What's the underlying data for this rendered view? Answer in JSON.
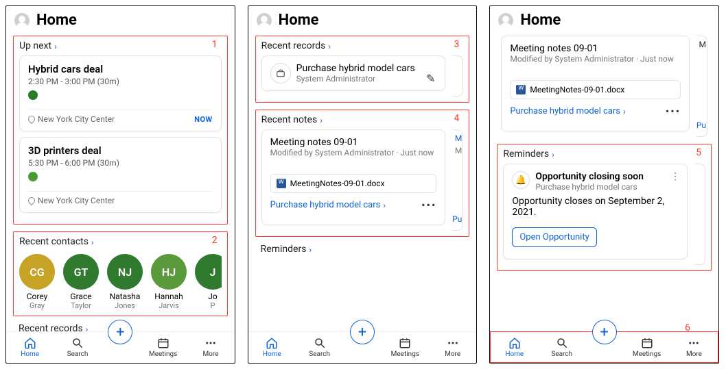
{
  "header": {
    "title": "Home"
  },
  "upnext": {
    "label": "Up next",
    "events": [
      {
        "title": "Hybrid cars deal",
        "time": "2:30 PM - 3:00 PM (30m)",
        "dot": "#2a7a2a",
        "loc": "New York City Center",
        "badge": "NOW"
      },
      {
        "title": "3D printers deal",
        "time": "5:30 PM - 6:00 PM (30m)",
        "dot": "#4a9a3a",
        "loc": "New York City Center",
        "badge": ""
      }
    ]
  },
  "recentContacts": {
    "label": "Recent contacts",
    "items": [
      {
        "initials": "CG",
        "color": "#c6a227",
        "first": "Corey",
        "last": "Gray"
      },
      {
        "initials": "GT",
        "color": "#2f7a2f",
        "first": "Grace",
        "last": "Taylor"
      },
      {
        "initials": "NJ",
        "color": "#2f7a2f",
        "first": "Natasha",
        "last": "Jones"
      },
      {
        "initials": "HJ",
        "color": "#5a9a3a",
        "first": "Hannah",
        "last": "Jarvis"
      },
      {
        "initials": "J",
        "color": "#2f7a2f",
        "first": "Jo",
        "last": "P"
      }
    ]
  },
  "recentRecords": {
    "label": "Recent records",
    "item": {
      "title": "Purchase hybrid model cars",
      "sub": "System Administrator"
    }
  },
  "recentNotes": {
    "label": "Recent notes",
    "item": {
      "title": "Meeting notes 09-01",
      "sub": "Modified by System Administrator · Just now",
      "file": "MeetingNotes-09-01.docx",
      "link": "Purchase hybrid model cars",
      "peekLink": "Pu",
      "peekTitle": "M",
      "peekSub": "M"
    }
  },
  "reminders": {
    "label": "Reminders",
    "item": {
      "title": "Opportunity closing soon",
      "sub": "Purchase hybrid model cars",
      "body": "Opportunity closes on September 2, 2021.",
      "cta": "Open Opportunity"
    }
  },
  "tabs": {
    "home": "Home",
    "search": "Search",
    "meetings": "Meetings",
    "more": "More"
  },
  "annotations": {
    "n1": "1",
    "n2": "2",
    "n3": "3",
    "n4": "4",
    "n5": "5",
    "n6": "6"
  }
}
